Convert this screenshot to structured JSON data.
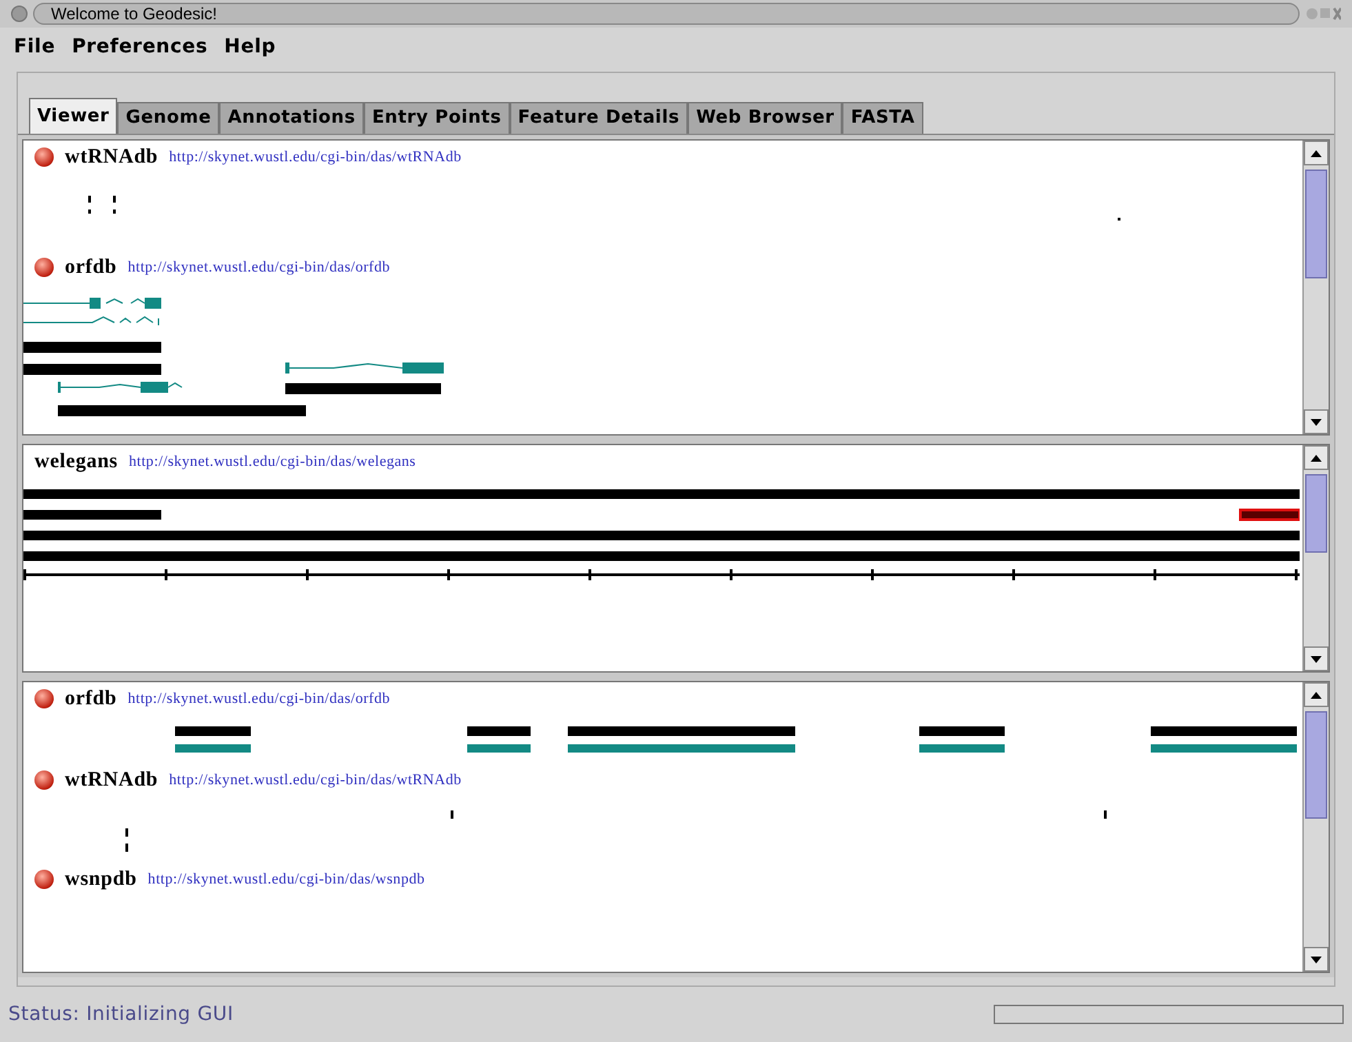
{
  "window": {
    "title": "Welcome to Geodesic!"
  },
  "menu": [
    "File",
    "Preferences",
    "Help"
  ],
  "tabs": [
    {
      "label": "Viewer",
      "selected": true
    },
    {
      "label": "Genome",
      "selected": false
    },
    {
      "label": "Annotations",
      "selected": false
    },
    {
      "label": "Entry Points",
      "selected": false
    },
    {
      "label": "Feature Details",
      "selected": false
    },
    {
      "label": "Web Browser",
      "selected": false
    },
    {
      "label": "FASTA",
      "selected": false
    }
  ],
  "panels": [
    {
      "tracks": [
        {
          "name": "wtRNAdb",
          "url": "http://skynet.wustl.edu/cgi-bin/das/wtRNAdb",
          "light": true
        },
        {
          "name": "orfdb",
          "url": "http://skynet.wustl.edu/cgi-bin/das/orfdb",
          "light": true
        }
      ]
    },
    {
      "tracks": [
        {
          "name": "welegans",
          "url": "http://skynet.wustl.edu/cgi-bin/das/welegans",
          "light": false
        }
      ]
    },
    {
      "tracks": [
        {
          "name": "orfdb",
          "url": "http://skynet.wustl.edu/cgi-bin/das/orfdb",
          "light": true
        },
        {
          "name": "wtRNAdb",
          "url": "http://skynet.wustl.edu/cgi-bin/das/wtRNAdb",
          "light": true
        },
        {
          "name": "wsnpdb",
          "url": "http://skynet.wustl.edu/cgi-bin/das/wsnpdb",
          "light": true
        }
      ]
    }
  ],
  "status_bar": {
    "text": "Status: Initializing GUI",
    "progress": {
      "level": 0
    }
  }
}
